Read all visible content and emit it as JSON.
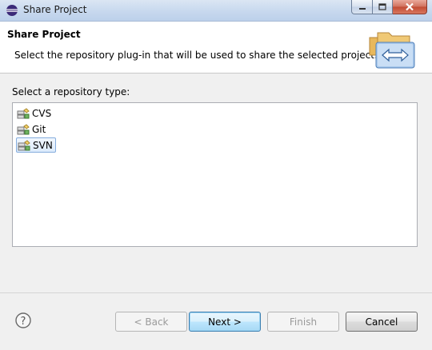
{
  "window": {
    "title": "Share Project"
  },
  "header": {
    "title": "Share Project",
    "description": "Select the repository plug-in that will be used to share the selected project."
  },
  "list": {
    "label": "Select a repository type:",
    "items": [
      {
        "label": "CVS",
        "icon": "repository-icon"
      },
      {
        "label": "Git",
        "icon": "repository-icon"
      },
      {
        "label": "SVN",
        "icon": "repository-icon",
        "selected": true
      }
    ]
  },
  "buttons": {
    "back": "< Back",
    "next": "Next >",
    "finish": "Finish",
    "cancel": "Cancel"
  },
  "colors": {
    "selection_border": "#84acdd",
    "default_button": "#3c7fb1"
  }
}
